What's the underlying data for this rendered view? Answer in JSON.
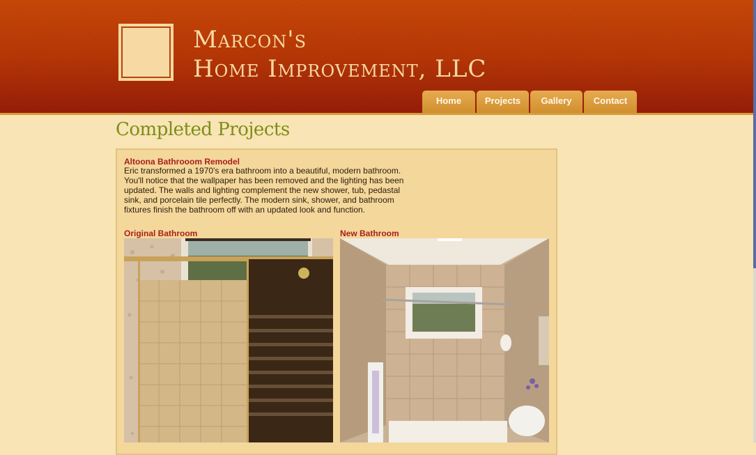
{
  "site": {
    "name_line1": "Marcon's",
    "name_line2": "Home Improvement, LLC"
  },
  "nav": {
    "items": [
      "Home",
      "Projects",
      "Gallery",
      "Contact"
    ]
  },
  "page": {
    "title": "Completed Projects"
  },
  "project": {
    "title": "Altoona Bathrooom Remodel",
    "description": "Eric transformed a 1970's era bathroom into a beautiful, modern bathroom. You'll notice that the wallpaper has been removed and the lighting has been updated. The walls and lighting complement the new shower, tub, pedastal sink, and porcelain tile perfectly. The modern sink, shower, and bathroom fixtures finish the bathroom off with an updated look and function.",
    "original_label": "Original Bathroom",
    "new_label": "New Bathroom"
  },
  "colors": {
    "header": "#b63706",
    "page_bg": "#f8e4b4",
    "title_green": "#7d8d1a",
    "label_red": "#a8201a",
    "tab_gold": "#d99a3c"
  }
}
